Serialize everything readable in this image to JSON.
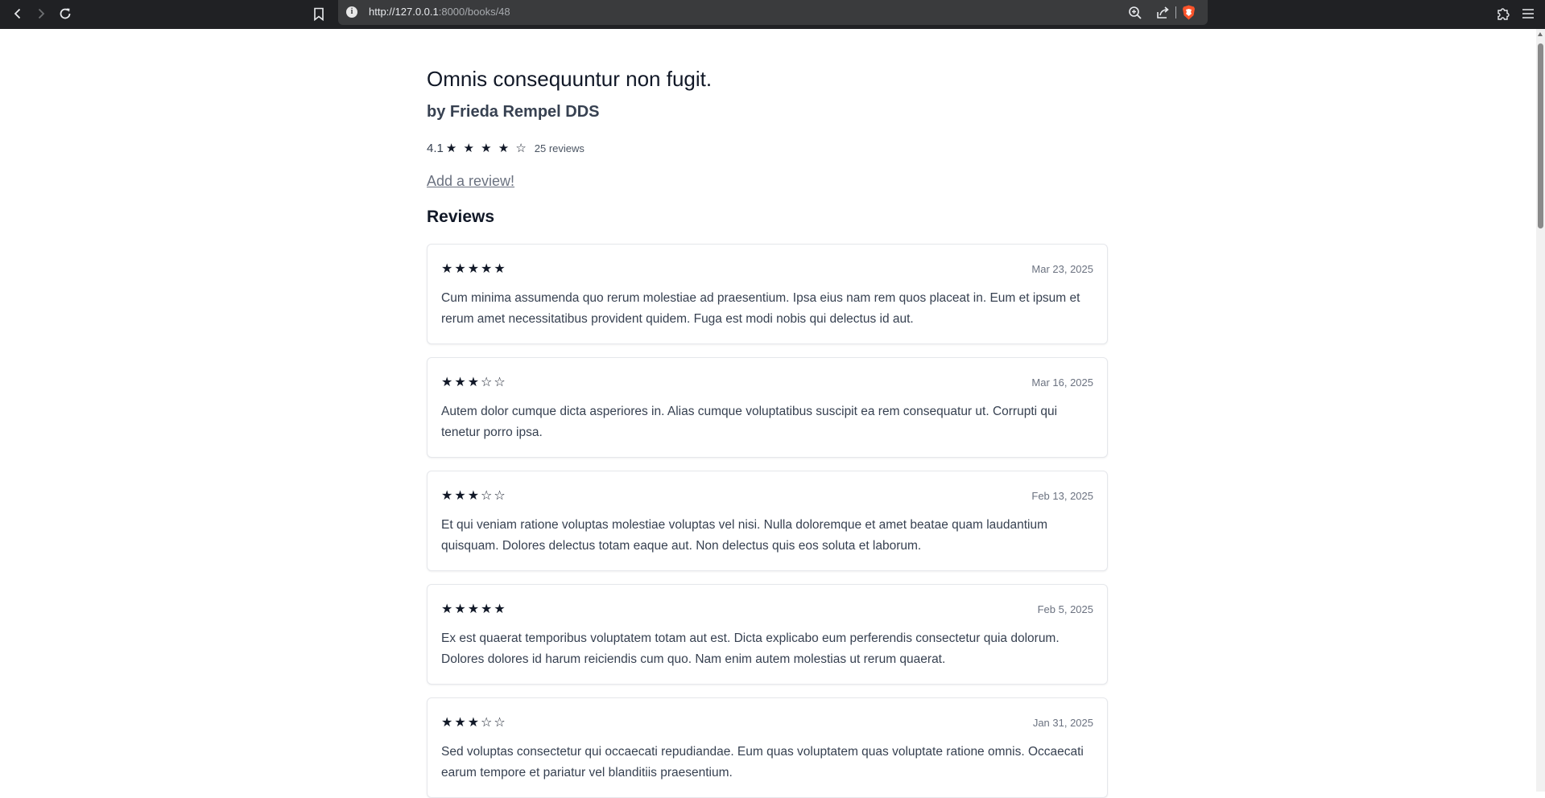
{
  "browser": {
    "url_host": "http://127.0.0.1",
    "url_path": ":8000/books/48"
  },
  "book": {
    "title": "Omnis consequuntur non fugit.",
    "author": "by Frieda Rempel DDS",
    "average_rating": "4.1",
    "average_stars": "★ ★ ★ ★ ☆",
    "review_count": "25 reviews",
    "add_review_label": "Add a review!"
  },
  "reviews_heading": "Reviews",
  "reviews": [
    {
      "rating": 5,
      "stars": "★★★★★",
      "date": "Mar 23, 2025",
      "body": "Cum minima assumenda quo rerum molestiae ad praesentium. Ipsa eius nam rem quos placeat in. Eum et ipsum et rerum amet necessitatibus provident quidem. Fuga est modi nobis qui delectus id aut."
    },
    {
      "rating": 3,
      "stars": "★★★☆☆",
      "date": "Mar 16, 2025",
      "body": "Autem dolor cumque dicta asperiores in. Alias cumque voluptatibus suscipit ea rem consequatur ut. Corrupti qui tenetur porro ipsa."
    },
    {
      "rating": 3,
      "stars": "★★★☆☆",
      "date": "Feb 13, 2025",
      "body": "Et qui veniam ratione voluptas molestiae voluptas vel nisi. Nulla doloremque et amet beatae quam laudantium quisquam. Dolores delectus totam eaque aut. Non delectus quis eos soluta et laborum."
    },
    {
      "rating": 5,
      "stars": "★★★★★",
      "date": "Feb 5, 2025",
      "body": "Ex est quaerat temporibus voluptatem totam aut est. Dicta explicabo eum perferendis consectetur quia dolorum. Dolores dolores id harum reiciendis cum quo. Nam enim autem molestias ut rerum quaerat."
    },
    {
      "rating": 3,
      "stars": "★★★☆☆",
      "date": "Jan 31, 2025",
      "body": "Sed voluptas consectetur qui occaecati repudiandae. Eum quas voluptatem quas voluptate ratione omnis. Occaecati earum tempore et pariatur vel blanditiis praesentium."
    }
  ],
  "colors": {
    "toolbar_bg": "#202124",
    "urlbar_bg": "#3a3b3d",
    "brave_orange": "#fb542b",
    "text_primary": "#111827",
    "text_body": "#374151",
    "text_muted": "#6b7280"
  }
}
